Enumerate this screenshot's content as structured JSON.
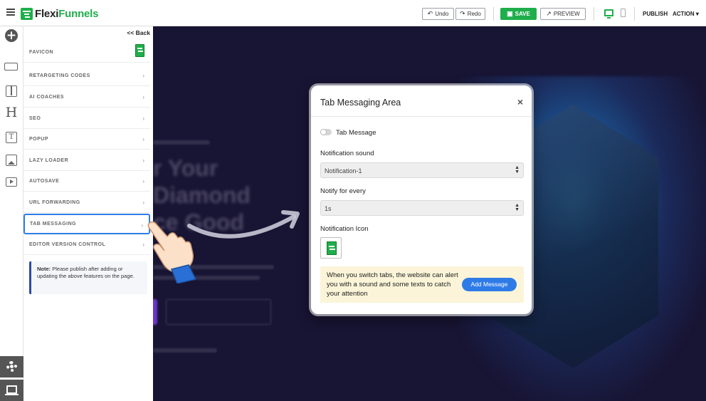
{
  "topbar": {
    "logo_prefix": "Flexi",
    "logo_suffix": "Funnels",
    "undo_label": "Undo",
    "redo_label": "Redo",
    "save_label": "SAVE",
    "preview_label": "PREVIEW",
    "publish_label": "PUBLISH",
    "action_label": "ACTION ▾",
    "accent_color": "#1fae4b"
  },
  "sidebar": {
    "back_label": "<< Back",
    "items": [
      {
        "label": "FAVICON"
      },
      {
        "label": "RETARGETING CODES"
      },
      {
        "label": "AI COACHES"
      },
      {
        "label": "SEO"
      },
      {
        "label": "POPUP"
      },
      {
        "label": "LAZY LOADER"
      },
      {
        "label": "AUTOSAVE"
      },
      {
        "label": "URL FORWARDING"
      },
      {
        "label": "TAB MESSAGING"
      },
      {
        "label": "EDITOR VERSION CONTROL"
      }
    ],
    "chevron": "›",
    "note_bold": "Note:",
    "note_text": " Please publish after adding or updating the above features on the page."
  },
  "rail": {
    "icons": [
      "add-element-icon",
      "section-icon",
      "columns-icon",
      "heading-icon",
      "text-icon",
      "image-icon",
      "video-icon",
      "settings-gear-icon",
      "laptop-icon"
    ]
  },
  "background": {
    "headline_line1": "r Your",
    "headline_line2": "Diamond",
    "headline_line3": "ce Good"
  },
  "modal": {
    "title": "Tab Messaging Area",
    "close": "×",
    "toggle_label": "Tab Message",
    "sound_label": "Notification sound",
    "sound_value": "Notification-1",
    "notify_label": "Notify for every",
    "notify_value": "1s",
    "icon_label": "Notification Icon",
    "info_text": "When you switch tabs, the website can alert you with a sound and some texts to catch your attention",
    "add_button": "Add Message",
    "accent_color": "#2e7be8",
    "info_bg": "#fbf4d8"
  }
}
